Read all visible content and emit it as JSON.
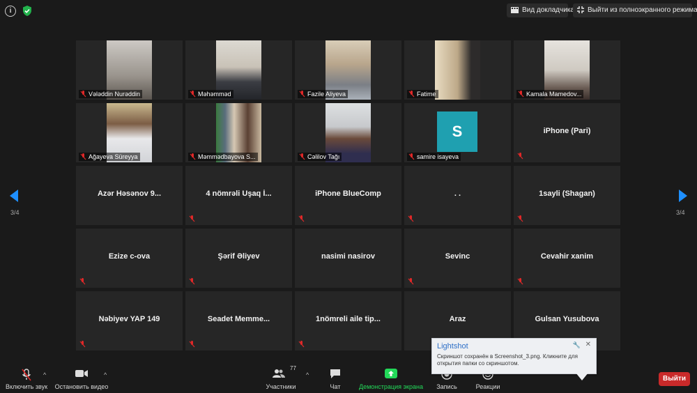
{
  "window": {
    "speaker_view_label": "Вид докладчика",
    "exit_fullscreen_label": "Выйти из полноэкранного режима"
  },
  "pagination": {
    "left": "3/4",
    "right": "3/4"
  },
  "tiles": [
    {
      "name": "Vəlәddin Nurəddin",
      "video": true,
      "muted": true
    },
    {
      "name": "Məhəmməd",
      "video": true,
      "muted": true
    },
    {
      "name": "Fazile Aliyeva",
      "video": true,
      "muted": true
    },
    {
      "name": "Fatime",
      "video": true,
      "muted": true
    },
    {
      "name": "Kamala Mamedov...",
      "video": true,
      "muted": true
    },
    {
      "name": "Ağayeva Süreyya",
      "video": true,
      "muted": true
    },
    {
      "name": "Məmmədbayova S...",
      "video": true,
      "muted": true
    },
    {
      "name": "Cəlilov Tağı",
      "video": true,
      "muted": true
    },
    {
      "name": "samire isayeva",
      "avatar_letter": "S",
      "muted": true
    },
    {
      "name": "iPhone (Pari)",
      "muted": true
    },
    {
      "name": "Azər Həsənov 9...",
      "muted": false
    },
    {
      "name": "4 nömrəli Uşaq İ...",
      "muted": true
    },
    {
      "name": "iPhone BlueComp",
      "muted": true
    },
    {
      "name": ". .",
      "muted": true
    },
    {
      "name": "1sayli (Shagan)",
      "muted": true
    },
    {
      "name": "Ezize c-ova",
      "muted": true
    },
    {
      "name": "Şərif Əliyev",
      "muted": true
    },
    {
      "name": "nasimi nasirov",
      "muted": true
    },
    {
      "name": "Sevinc",
      "muted": true
    },
    {
      "name": "Cevahir xanim",
      "muted": true
    },
    {
      "name": "Nəbiyev YAP 149",
      "muted": true
    },
    {
      "name": "Seadet  Memme...",
      "muted": true
    },
    {
      "name": "1nömreli aile tip...",
      "muted": true
    },
    {
      "name": "Araz",
      "muted": false
    },
    {
      "name": "Gulsan Yusubova",
      "muted": false
    }
  ],
  "toolbar": {
    "unmute": "Включить звук",
    "stop_video": "Остановить видео",
    "participants": "Участники",
    "participants_count": "77",
    "chat": "Чат",
    "share_screen": "Демонстрация экрана",
    "record": "Запись",
    "reactions": "Реакции",
    "leave": "Выйти"
  },
  "toast": {
    "title": "Lightshot",
    "message": "Скриншот сохранён в Screenshot_3.png. Кликните для открытия папки со скриншотом."
  },
  "colors": {
    "accent": "#1e8fff",
    "leave": "#c92a2a",
    "share_green": "#23d959",
    "mute_red": "#e02828"
  }
}
